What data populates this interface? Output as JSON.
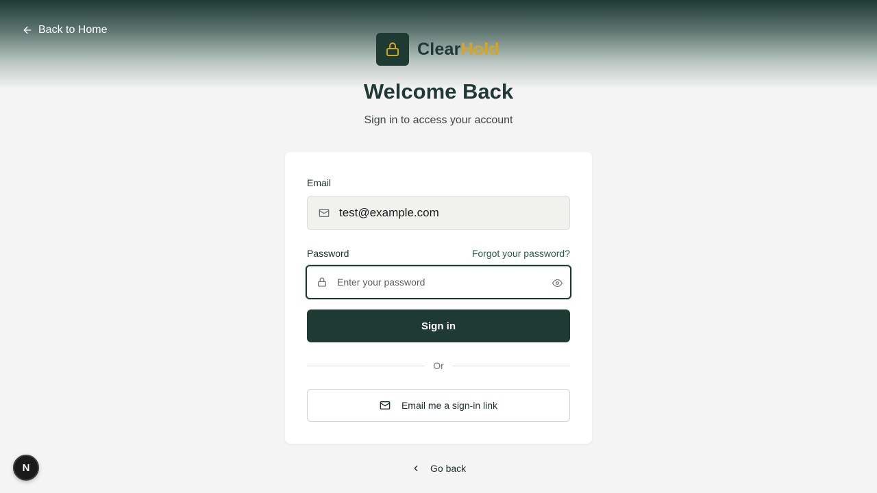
{
  "nav": {
    "back_home_label": "Back to Home"
  },
  "brand": {
    "name_part1": "Clear",
    "name_part2": "Hold",
    "primary_color": "#1e3a33",
    "accent_color": "#d6a526"
  },
  "header": {
    "title": "Welcome Back",
    "subtitle": "Sign in to access your account"
  },
  "form": {
    "email_label": "Email",
    "email_value": "test@example.com",
    "password_label": "Password",
    "forgot_label": "Forgot your password?",
    "password_placeholder": "Enter your password",
    "signin_label": "Sign in",
    "divider_text": "Or",
    "magic_link_label": "Email me a sign-in link"
  },
  "footer": {
    "go_back_label": "Go back"
  },
  "dev_badge": {
    "letter": "N"
  },
  "icons": {
    "back": "arrow-left-icon",
    "logo": "lock-icon",
    "email": "mail-icon",
    "password": "lock-icon",
    "toggle": "eye-icon",
    "magic": "mail-icon",
    "go_back": "chevron-left-icon"
  }
}
